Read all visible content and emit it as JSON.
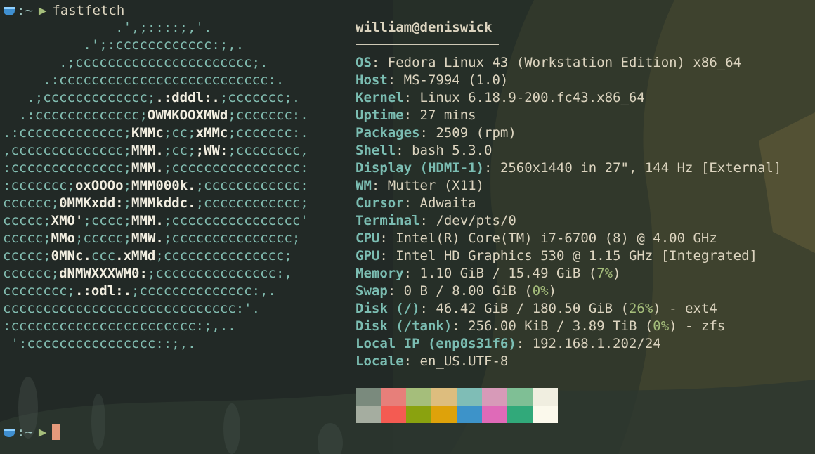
{
  "prompt": {
    "icon": "shell-icon",
    "path": ":~",
    "command": "fastfetch"
  },
  "logo": {
    "lines": [
      [
        {
          "t": "              .',;::::;,'.",
          "h": false
        }
      ],
      [
        {
          "t": "          .';:cccccccccccc:;,.",
          "h": false
        }
      ],
      [
        {
          "t": "       .;cccccccccccccccccccccc;.",
          "h": false
        }
      ],
      [
        {
          "t": "     .:cccccccccccccccccccccccccc:.",
          "h": false
        }
      ],
      [
        {
          "t": "   .;ccccccccccccc;",
          "h": false
        },
        {
          "t": ".:dddl:.",
          "h": true
        },
        {
          "t": ";ccccccc;.",
          "h": false
        }
      ],
      [
        {
          "t": "  .:ccccccccccccc;",
          "h": false
        },
        {
          "t": "OWMKOOXMWd",
          "h": true
        },
        {
          "t": ";ccccccc:.",
          "h": false
        }
      ],
      [
        {
          "t": ".:ccccccccccccc;",
          "h": false
        },
        {
          "t": "KMMc",
          "h": true
        },
        {
          "t": ";cc;",
          "h": false
        },
        {
          "t": "xMMc",
          "h": true
        },
        {
          "t": ";ccccccc:.",
          "h": false
        }
      ],
      [
        {
          "t": ",cccccccccccccc;",
          "h": false
        },
        {
          "t": "MMM.",
          "h": true
        },
        {
          "t": ";cc;",
          "h": false
        },
        {
          "t": ";WW:",
          "h": true
        },
        {
          "t": ";cccccccc,",
          "h": false
        }
      ],
      [
        {
          "t": ":cccccccccccccc;",
          "h": false
        },
        {
          "t": "MMM.",
          "h": true
        },
        {
          "t": ";cccccccccccccccc:",
          "h": false
        }
      ],
      [
        {
          "t": ":ccccccc;",
          "h": false
        },
        {
          "t": "oxOOOo",
          "h": true
        },
        {
          "t": ";",
          "h": false
        },
        {
          "t": "MMM000k.",
          "h": true
        },
        {
          "t": ";cccccccccccc:",
          "h": false
        }
      ],
      [
        {
          "t": "cccccc;",
          "h": false
        },
        {
          "t": "0MMKxdd:",
          "h": true
        },
        {
          "t": ";",
          "h": false
        },
        {
          "t": "MMMkddc.",
          "h": true
        },
        {
          "t": ";cccccccccccc;",
          "h": false
        }
      ],
      [
        {
          "t": "ccccc;",
          "h": false
        },
        {
          "t": "XMO'",
          "h": true
        },
        {
          "t": ";cccc;",
          "h": false
        },
        {
          "t": "MMM.",
          "h": true
        },
        {
          "t": ";cccccccccccccccc'",
          "h": false
        }
      ],
      [
        {
          "t": "ccccc;",
          "h": false
        },
        {
          "t": "MMo",
          "h": true
        },
        {
          "t": ";ccccc;",
          "h": false
        },
        {
          "t": "MMW.",
          "h": true
        },
        {
          "t": ";ccccccccccccccc;",
          "h": false
        }
      ],
      [
        {
          "t": "ccccc;",
          "h": false
        },
        {
          "t": "0MNc.",
          "h": true
        },
        {
          "t": "ccc",
          "h": false
        },
        {
          "t": ".xMMd",
          "h": true
        },
        {
          "t": ";ccccccccccccccc;",
          "h": false
        }
      ],
      [
        {
          "t": "cccccc;",
          "h": false
        },
        {
          "t": "dNMWXXXWM0:",
          "h": true
        },
        {
          "t": ";ccccccccccccccc:,",
          "h": false
        }
      ],
      [
        {
          "t": "cccccccc;",
          "h": false
        },
        {
          "t": ".:odl:.",
          "h": true
        },
        {
          "t": ";cccccccccccccc:,.",
          "h": false
        }
      ],
      [
        {
          "t": "ccccccccccccccccccccccccccccc:'.",
          "h": false
        }
      ],
      [
        {
          "t": ":ccccccccccccccccccccccc:;,..",
          "h": false
        }
      ],
      [
        {
          "t": " ':cccccccccccccccc::;,.",
          "h": false
        }
      ]
    ]
  },
  "info": {
    "title": "william@deniswick",
    "rows": [
      {
        "key": "OS",
        "parts": [
          {
            "t": "Fedora Linux 43 (Workstation Edition) x86_64"
          }
        ]
      },
      {
        "key": "Host",
        "parts": [
          {
            "t": "MS-7994 (1.0)"
          }
        ]
      },
      {
        "key": "Kernel",
        "parts": [
          {
            "t": "Linux 6.18.9-200.fc43.x86_64"
          }
        ]
      },
      {
        "key": "Uptime",
        "parts": [
          {
            "t": "27 mins"
          }
        ]
      },
      {
        "key": "Packages",
        "parts": [
          {
            "t": "2509 (rpm)"
          }
        ]
      },
      {
        "key": "Shell",
        "parts": [
          {
            "t": "bash 5.3.0"
          }
        ]
      },
      {
        "key": "Display (HDMI-1)",
        "parts": [
          {
            "t": "2560x1440 in 27\", 144 Hz [External]"
          }
        ]
      },
      {
        "key": "WM",
        "parts": [
          {
            "t": "Mutter (X11)"
          }
        ]
      },
      {
        "key": "Cursor",
        "parts": [
          {
            "t": "Adwaita"
          }
        ]
      },
      {
        "key": "Terminal",
        "parts": [
          {
            "t": "/dev/pts/0"
          }
        ]
      },
      {
        "key": "CPU",
        "parts": [
          {
            "t": "Intel(R) Core(TM) i7-6700 (8) @ 4.00 GHz"
          }
        ]
      },
      {
        "key": "GPU",
        "parts": [
          {
            "t": "Intel HD Graphics 530 @ 1.15 GHz [Integrated]"
          }
        ]
      },
      {
        "key": "Memory",
        "parts": [
          {
            "t": "1.10 GiB / 15.49 GiB ("
          },
          {
            "t": "7%",
            "c": "pct"
          },
          {
            "t": ")"
          }
        ]
      },
      {
        "key": "Swap",
        "parts": [
          {
            "t": "0 B / 8.00 GiB ("
          },
          {
            "t": "0%",
            "c": "pct"
          },
          {
            "t": ")"
          }
        ]
      },
      {
        "key": "Disk (/)",
        "parts": [
          {
            "t": "46.42 GiB / 180.50 GiB ("
          },
          {
            "t": "26%",
            "c": "pct"
          },
          {
            "t": ") - ext4"
          }
        ]
      },
      {
        "key": "Disk (/tank)",
        "parts": [
          {
            "t": "256.00 KiB / 3.89 TiB ("
          },
          {
            "t": "0%",
            "c": "pct"
          },
          {
            "t": ") - zfs"
          }
        ]
      },
      {
        "key": "Local IP (enp0s31f6)",
        "parts": [
          {
            "t": "192.168.1.202/24"
          }
        ]
      },
      {
        "key": "Locale",
        "parts": [
          {
            "t": "en_US.UTF-8"
          }
        ]
      }
    ]
  },
  "palette": {
    "normal": [
      "#7a8a7d",
      "#e77f7a",
      "#a5be7b",
      "#ddbd7e",
      "#7fbdb6",
      "#d79ab8",
      "#7fbf95",
      "#f0eee0"
    ],
    "bright": [
      "#a5ada0",
      "#f45b52",
      "#8aa20f",
      "#dea20a",
      "#3d93c9",
      "#df6ab8",
      "#31a97a",
      "#fbf9ec"
    ]
  }
}
